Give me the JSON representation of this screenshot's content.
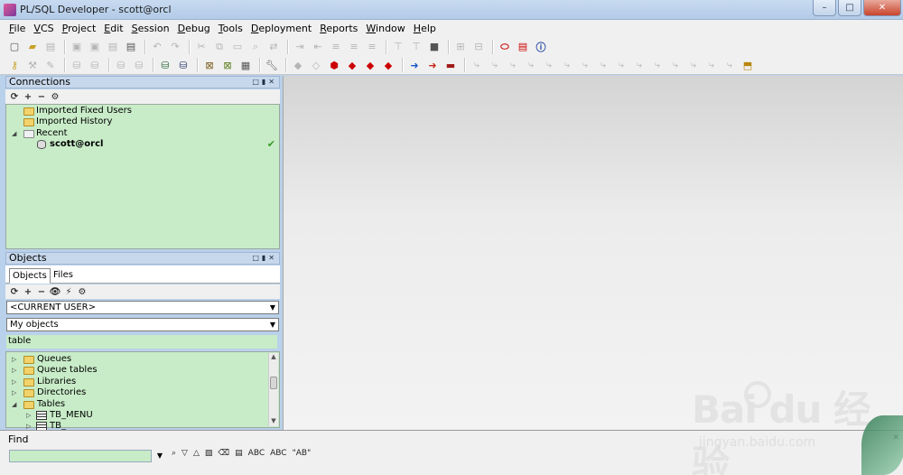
{
  "window": {
    "title": "PL/SQL Developer - scott@orcl",
    "min": "–",
    "max": "□",
    "close": "✕"
  },
  "menu": [
    "File",
    "VCS",
    "Project",
    "Edit",
    "Session",
    "Debug",
    "Tools",
    "Deployment",
    "Reports",
    "Window",
    "Help"
  ],
  "connections": {
    "title": "Connections",
    "items": [
      {
        "label": "Imported Fixed Users"
      },
      {
        "label": "Imported History"
      },
      {
        "label": "Recent"
      },
      {
        "label": "scott@orcl"
      }
    ]
  },
  "objects": {
    "title": "Objects",
    "tabs": [
      "Objects",
      "Files"
    ],
    "user_combo": "<CURRENT USER>",
    "filter_combo": "My objects",
    "filter_text": "table",
    "tree": [
      "Queues",
      "Queue tables",
      "Libraries",
      "Directories",
      "Tables",
      "TB_MENU",
      "TB_"
    ]
  },
  "find": {
    "label": "Find",
    "abc": "ABC",
    "abc2": "ABC",
    "ab": "\"AB\""
  },
  "watermark": {
    "logo": "Bai du 经验",
    "url": "jingyan.baidu.com"
  },
  "icons": {
    "refresh": "⟳",
    "add": "+",
    "remove": "−",
    "binoculars": "👁",
    "config": "⚙"
  }
}
